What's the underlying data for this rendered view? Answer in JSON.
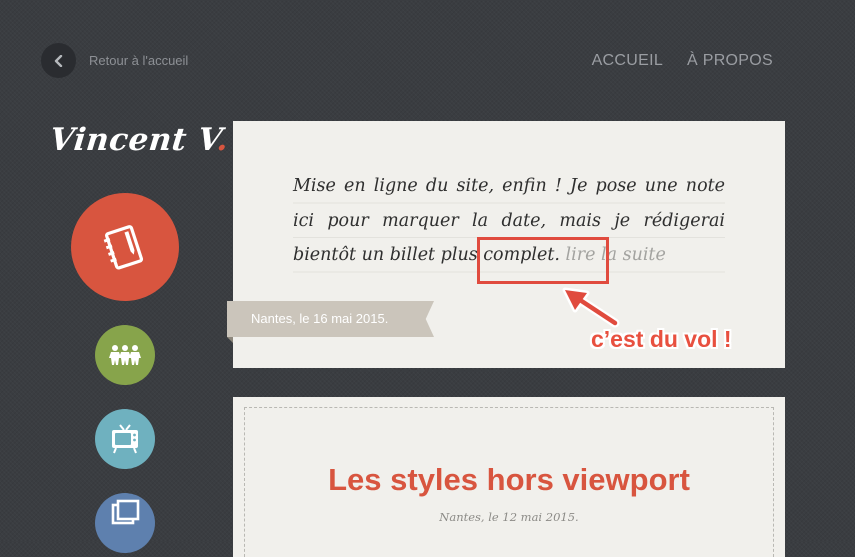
{
  "header": {
    "back_label": "Retour à l'accueil",
    "nav": [
      {
        "label": "ACCUEIL"
      },
      {
        "label": "À PROPOS"
      }
    ]
  },
  "logo": {
    "name": "Vincent V",
    "dot": "."
  },
  "sidebar": {
    "items": [
      {
        "icon": "notebook-icon",
        "color": "#d8553f"
      },
      {
        "icon": "people-icon",
        "color": "#87a44b"
      },
      {
        "icon": "tv-icon",
        "color": "#6fb1bf"
      },
      {
        "icon": "photos-icon",
        "color": "#5e80ae"
      }
    ]
  },
  "posts": [
    {
      "excerpt": "Mise en ligne du site, enfin ! Je pose une note ici pour marquer la date, mais je rédigerai bientôt un billet plus complet.",
      "read_more": "lire la suite",
      "date": "Nantes, le 16 mai 2015."
    },
    {
      "title": "Les styles hors viewport",
      "date": "Nantes, le 12 mai 2015."
    }
  ],
  "annotation": {
    "text": "c’est du vol !",
    "color": "#e8503f"
  },
  "colors": {
    "background": "#3a3d41",
    "accent": "#d8553f",
    "card": "#f1f0ec"
  }
}
